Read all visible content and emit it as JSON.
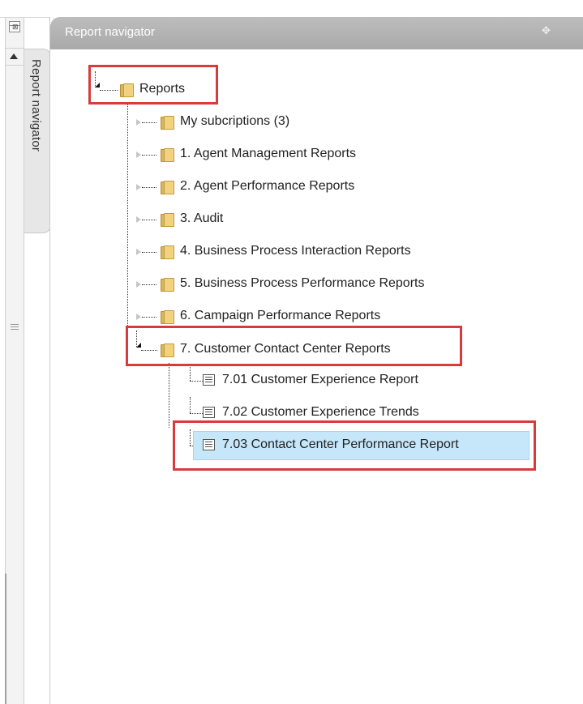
{
  "panel": {
    "title": "Report navigator",
    "tab_label": "Report navigator",
    "icons": {
      "pin": "pin-icon",
      "dock": "dock-icon",
      "collapse": "collapse-arrow-icon"
    }
  },
  "tree": {
    "root": "Reports",
    "items": [
      "My subcriptions (3)",
      "1. Agent Management Reports",
      "2. Agent Performance Reports",
      "3. Audit",
      "4. Business Process Interaction Reports",
      "5. Business Process Performance Reports",
      "6. Campaign Performance Reports",
      "7. Customer Contact Center Reports"
    ],
    "children_of_7": [
      "7.01 Customer Experience Report",
      "7.02 Customer Experience Trends",
      "7.03 Contact Center Performance Report"
    ],
    "selected": "7.03 Contact Center Performance Report"
  },
  "colors": {
    "highlight_border": "#d93b3b",
    "selected_bg": "#c6e6f9",
    "header_bg": "#b3b3b3"
  }
}
